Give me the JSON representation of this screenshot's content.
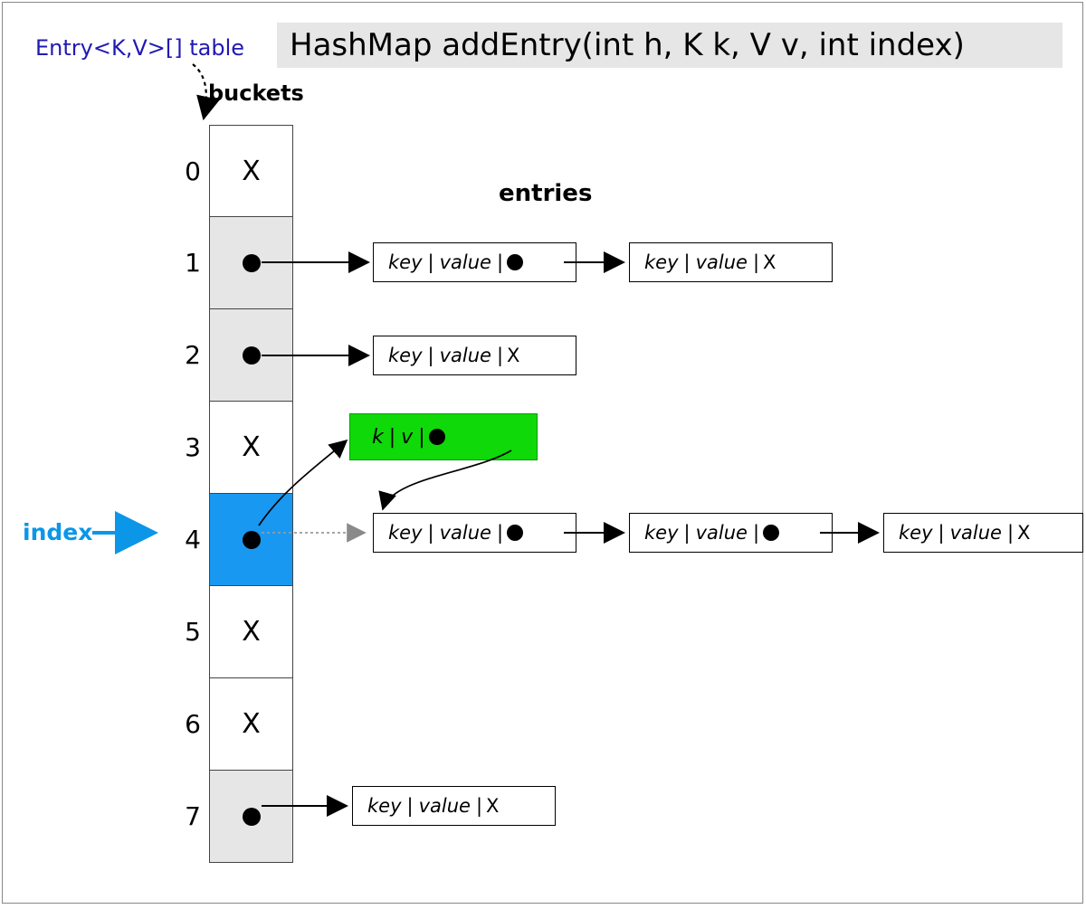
{
  "title": "HashMap addEntry(int h, K k, V v, int index)",
  "table_label": "Entry<K,V>[] table",
  "buckets_label": "buckets",
  "entries_label": "entries",
  "index_label": "index",
  "null_marker": "X",
  "key_text": "key",
  "value_text": "value",
  "new_entry": {
    "k": "k",
    "v": "v"
  },
  "highlight_index": 4,
  "buckets": [
    {
      "index": 0,
      "state": "null",
      "bg": "white"
    },
    {
      "index": 1,
      "state": "ptr",
      "bg": "gray"
    },
    {
      "index": 2,
      "state": "ptr",
      "bg": "gray"
    },
    {
      "index": 3,
      "state": "null",
      "bg": "white"
    },
    {
      "index": 4,
      "state": "ptr",
      "bg": "blue"
    },
    {
      "index": 5,
      "state": "null",
      "bg": "white"
    },
    {
      "index": 6,
      "state": "null",
      "bg": "white"
    },
    {
      "index": 7,
      "state": "ptr",
      "bg": "gray"
    }
  ],
  "chains": {
    "1": [
      {
        "next": "ptr"
      },
      {
        "next": "null"
      }
    ],
    "2": [
      {
        "next": "null"
      }
    ],
    "4": [
      {
        "next": "ptr"
      },
      {
        "next": "ptr"
      },
      {
        "next": "null"
      }
    ],
    "7": [
      {
        "next": "null"
      }
    ]
  }
}
